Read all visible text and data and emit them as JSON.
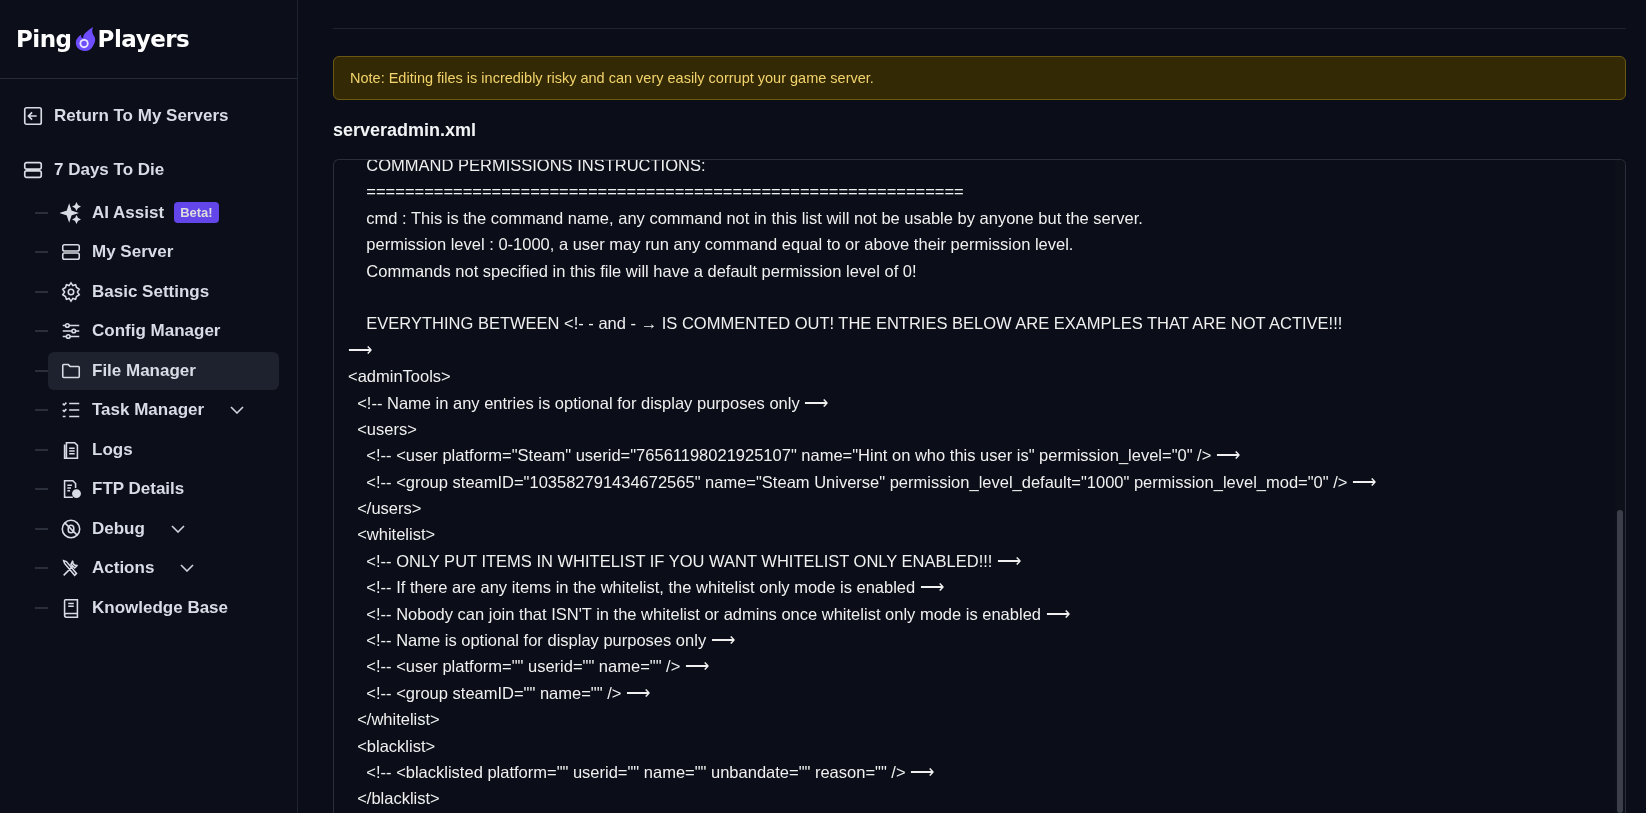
{
  "logo": {
    "left": "Ping",
    "right": "Players"
  },
  "sidebar": {
    "return_link": "Return To My Servers",
    "server": {
      "name": "7 Days To Die",
      "children": [
        {
          "label": "AI Assist",
          "badge": "Beta!",
          "selected": false,
          "has_submenu": false
        },
        {
          "label": "My Server",
          "selected": false,
          "has_submenu": false
        },
        {
          "label": "Basic Settings",
          "selected": false,
          "has_submenu": false
        },
        {
          "label": "Config Manager",
          "selected": false,
          "has_submenu": false
        },
        {
          "label": "File Manager",
          "selected": true,
          "has_submenu": false
        },
        {
          "label": "Task Manager",
          "selected": false,
          "has_submenu": true
        },
        {
          "label": "Logs",
          "selected": false,
          "has_submenu": false
        },
        {
          "label": "FTP Details",
          "selected": false,
          "has_submenu": false
        },
        {
          "label": "Debug",
          "selected": false,
          "has_submenu": true
        },
        {
          "label": "Actions",
          "selected": false,
          "has_submenu": true
        },
        {
          "label": "Knowledge Base",
          "selected": false,
          "has_submenu": false
        }
      ]
    }
  },
  "note": "Note: Editing files is incredibly risky and can very easily corrupt your game server.",
  "file_name": "serveradmin.xml",
  "editor_header_lines": [
    "    COMMAND PERMISSIONS INSTRUCTIONS:",
    "    ==============================================================",
    "    cmd : This is the command name, any command not in this list will not be usable by anyone but the server.",
    "    permission level : 0-1000, a user may run any command equal to or above their permission level.",
    "    Commands not specified in this file will have a default permission level of 0!"
  ],
  "editor_lines": [
    "    EVERYTHING BETWEEN <!- - and - → IS COMMENTED OUT! THE ENTRIES BELOW ARE EXAMPLES THAT ARE NOT ACTIVE!!!",
    "⟶",
    "<adminTools>",
    "  <!-- Name in any entries is optional for display purposes only ⟶",
    "  <users>",
    "    <!-- <user platform=\"Steam\" userid=\"76561198021925107\" name=\"Hint on who this user is\" permission_level=\"0\" /> ⟶",
    "    <!-- <group steamID=\"103582791434672565\" name=\"Steam Universe\" permission_level_default=\"1000\" permission_level_mod=\"0\" /> ⟶",
    "  </users>",
    "  <whitelist>",
    "    <!-- ONLY PUT ITEMS IN WHITELIST IF YOU WANT WHITELIST ONLY ENABLED!!! ⟶",
    "    <!-- If there are any items in the whitelist, the whitelist only mode is enabled ⟶",
    "    <!-- Nobody can join that ISN'T in the whitelist or admins once whitelist only mode is enabled ⟶",
    "    <!-- Name is optional for display purposes only ⟶",
    "    <!-- <user platform=\"\" userid=\"\" name=\"\" /> ⟶",
    "    <!-- <group steamID=\"\" name=\"\" /> ⟶",
    "  </whitelist>",
    "  <blacklist>",
    "    <!-- <blacklisted platform=\"\" userid=\"\" name=\"\" unbandate=\"\" reason=\"\" /> ⟶",
    "  </blacklist>"
  ]
}
